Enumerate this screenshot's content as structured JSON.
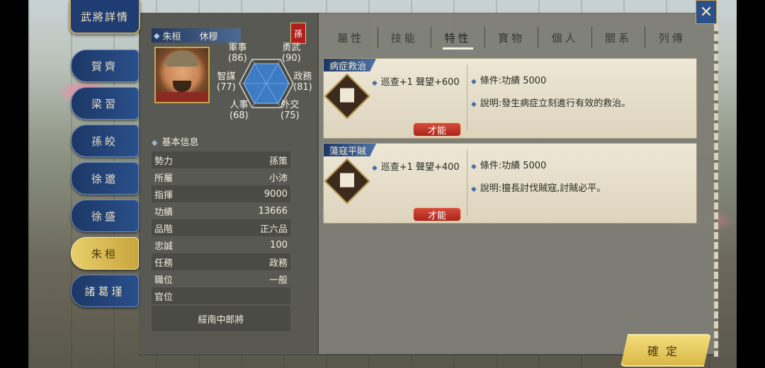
{
  "screen": {
    "title": "武將詳情"
  },
  "side_tabs": [
    {
      "label": "賀齊",
      "active": false
    },
    {
      "label": "梁習",
      "active": false
    },
    {
      "label": "孫皎",
      "active": false
    },
    {
      "label": "徐邈",
      "active": false
    },
    {
      "label": "徐盛",
      "active": false
    },
    {
      "label": "朱桓",
      "active": true
    },
    {
      "label": "諸葛瑾",
      "active": false
    }
  ],
  "general": {
    "name": "朱桓",
    "courtesy": "休穆",
    "faction_seal": "孫",
    "stats": {
      "military": {
        "label": "軍事",
        "value": "(86)"
      },
      "valor": {
        "label": "勇武",
        "value": "(90)"
      },
      "strategy": {
        "label": "智謀",
        "value": "(77)"
      },
      "politics": {
        "label": "政務",
        "value": "(81)"
      },
      "personnel": {
        "label": "人事",
        "value": "(68)"
      },
      "diplomacy": {
        "label": "外交",
        "value": "(75)"
      }
    }
  },
  "basic_info": {
    "header": "基本信息",
    "rows": [
      {
        "label": "勢力",
        "value": "孫策"
      },
      {
        "label": "所屬",
        "value": "小沛"
      },
      {
        "label": "指揮",
        "value": "9000"
      },
      {
        "label": "功績",
        "value": "13666"
      },
      {
        "label": "品階",
        "value": "正六品"
      },
      {
        "label": "忠誠",
        "value": "100"
      },
      {
        "label": "任務",
        "value": "政務"
      },
      {
        "label": "職位",
        "value": "一般"
      },
      {
        "label": "官位",
        "value": ""
      }
    ],
    "title": "綏南中郎將"
  },
  "tabs": [
    {
      "label": "屬性",
      "active": false
    },
    {
      "label": "技能",
      "active": false
    },
    {
      "label": "特性",
      "active": true
    },
    {
      "label": "寶物",
      "active": false
    },
    {
      "label": "個人",
      "active": false
    },
    {
      "label": "關系",
      "active": false
    },
    {
      "label": "列傳",
      "active": false
    }
  ],
  "traits": [
    {
      "name": "病症救治",
      "effect": "巡查+1 聲望+600",
      "condition": "條件:功績 5000",
      "description": "說明:發生病症立刻進行有效的救治。",
      "badge": "才能"
    },
    {
      "name": "蕩寇平賊",
      "effect": "巡查+1 聲望+400",
      "condition": "條件:功績 5000",
      "description": "說明:擅長討伐賊寇,討賊必平。",
      "badge": "才能"
    }
  ],
  "buttons": {
    "confirm": "確定",
    "close": "✕"
  },
  "colors": {
    "accent_blue": "#1f3d73",
    "gold": "#c9a74e",
    "badge_red": "#c0392b",
    "radar_fill": "#3d7bc4"
  }
}
